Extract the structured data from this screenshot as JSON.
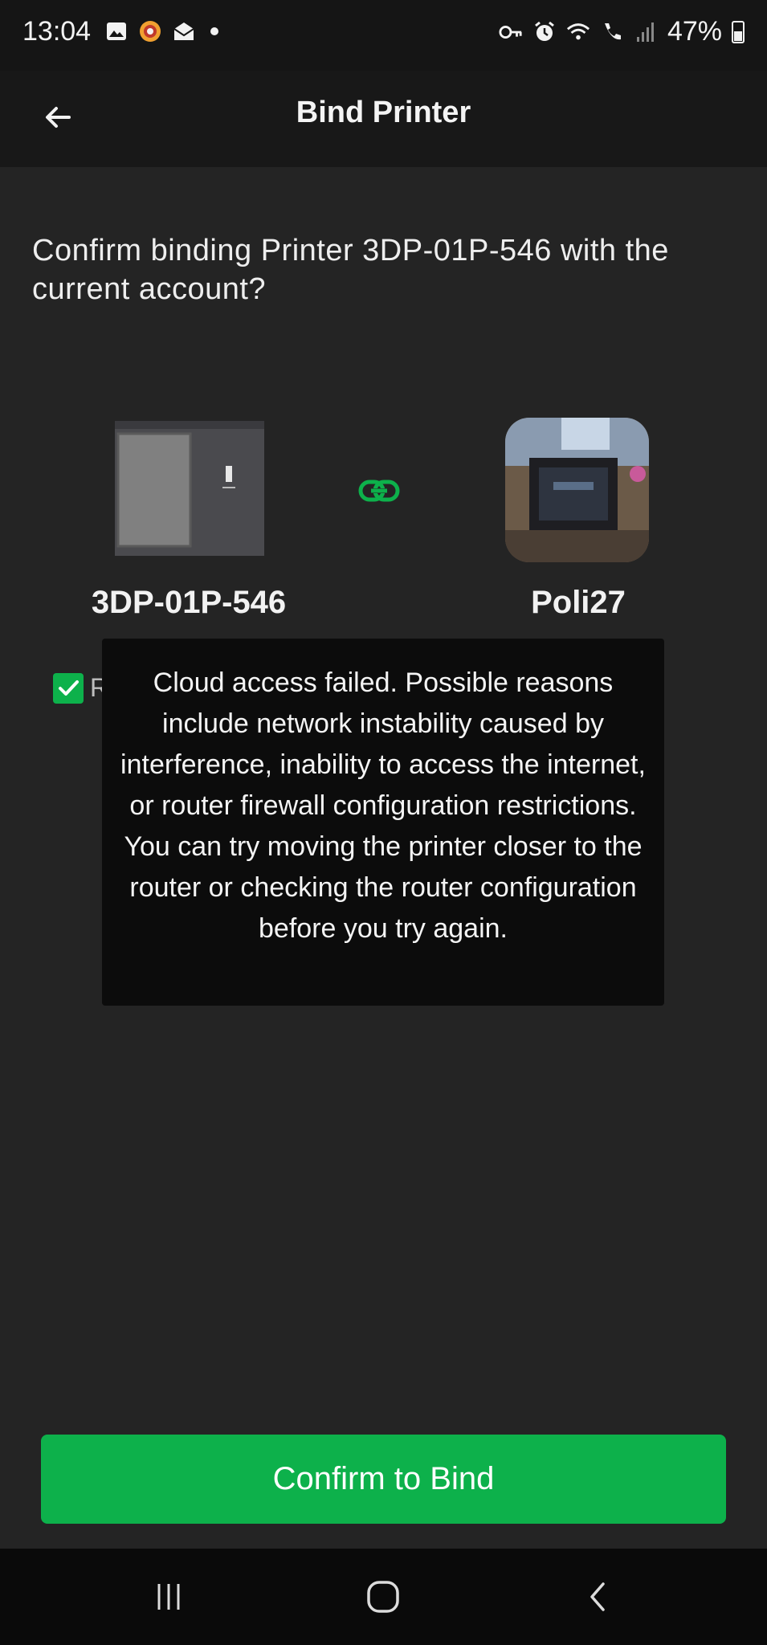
{
  "status_bar": {
    "time": "13:04",
    "battery": "47%",
    "left_icons": [
      "gallery-icon",
      "emoji-app-icon",
      "mail-open-icon",
      "notification-dot"
    ],
    "right_icons": [
      "vpn-key-icon",
      "alarm-icon",
      "wifi-icon",
      "wifi-call-icon",
      "signal-icon",
      "battery-icon"
    ]
  },
  "app_bar": {
    "title": "Bind Printer",
    "back_icon": "arrow-left-icon"
  },
  "question": "Confirm binding Printer 3DP-01P-546 with the current account?",
  "devices": {
    "printer_name": "3DP-01P-546",
    "account_name": "Poli27",
    "link_icon": "link-icon"
  },
  "agreement": {
    "checked": true,
    "visible_text": "Re"
  },
  "toast": {
    "message": "Cloud access failed. Possible reasons include network instability caused by interference, inability to access the internet, or router firewall configuration restrictions. You can try moving the printer closer to the router or checking the router configuration before you try again."
  },
  "confirm_button": {
    "label": "Confirm to Bind"
  },
  "colors": {
    "accent": "#0db14b",
    "background": "#242424",
    "toast_bg": "#0c0c0c"
  },
  "nav_bar": {
    "icons": [
      "recent-apps-icon",
      "home-icon",
      "back-nav-icon"
    ]
  }
}
